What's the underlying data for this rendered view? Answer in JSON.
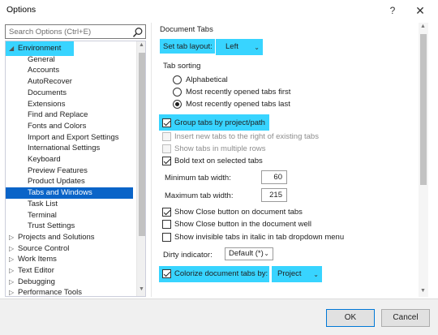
{
  "window": {
    "title": "Options",
    "help": "?",
    "close": "✕"
  },
  "search": {
    "placeholder": "Search Options (Ctrl+E)"
  },
  "tree": {
    "items": [
      {
        "label": "Environment",
        "level": 0,
        "expanded": true
      },
      {
        "label": "General",
        "level": 1
      },
      {
        "label": "Accounts",
        "level": 1
      },
      {
        "label": "AutoRecover",
        "level": 1
      },
      {
        "label": "Documents",
        "level": 1
      },
      {
        "label": "Extensions",
        "level": 1
      },
      {
        "label": "Find and Replace",
        "level": 1
      },
      {
        "label": "Fonts and Colors",
        "level": 1
      },
      {
        "label": "Import and Export Settings",
        "level": 1
      },
      {
        "label": "International Settings",
        "level": 1
      },
      {
        "label": "Keyboard",
        "level": 1
      },
      {
        "label": "Preview Features",
        "level": 1
      },
      {
        "label": "Product Updates",
        "level": 1
      },
      {
        "label": "Tabs and Windows",
        "level": 1,
        "selected": true
      },
      {
        "label": "Task List",
        "level": 1
      },
      {
        "label": "Terminal",
        "level": 1
      },
      {
        "label": "Trust Settings",
        "level": 1
      },
      {
        "label": "Projects and Solutions",
        "level": 0,
        "expanded": false
      },
      {
        "label": "Source Control",
        "level": 0,
        "expanded": false
      },
      {
        "label": "Work Items",
        "level": 0,
        "expanded": false
      },
      {
        "label": "Text Editor",
        "level": 0,
        "expanded": false
      },
      {
        "label": "Debugging",
        "level": 0,
        "expanded": false
      },
      {
        "label": "Performance Tools",
        "level": 0,
        "expanded": false
      }
    ]
  },
  "panel": {
    "section_title": "Document Tabs",
    "set_tab_layout_label": "Set tab layout:",
    "set_tab_layout_value": "Left",
    "tab_sorting_label": "Tab sorting",
    "sorting_options": [
      {
        "label": "Alphabetical",
        "checked": false
      },
      {
        "label": "Most recently opened tabs first",
        "checked": false
      },
      {
        "label": "Most recently opened tabs last",
        "checked": true
      }
    ],
    "group_tabs_label": "Group tabs by project/path",
    "insert_right_label": "Insert new tabs to the right of existing tabs",
    "show_multiple_rows_label": "Show tabs in multiple rows",
    "bold_text_label": "Bold text on selected tabs",
    "min_tab_width_label": "Minimum tab width:",
    "min_tab_width_value": "60",
    "max_tab_width_label": "Maximum tab width:",
    "max_tab_width_value": "215",
    "show_close_tab_label": "Show Close button on document tabs",
    "show_close_well_label": "Show Close button in the document well",
    "show_invisible_label": "Show invisible tabs in italic in tab dropdown menu",
    "dirty_indicator_label": "Dirty indicator:",
    "dirty_indicator_value": "Default (*)",
    "colorize_label": "Colorize document tabs by:",
    "colorize_value": "Project"
  },
  "footer": {
    "ok": "OK",
    "cancel": "Cancel"
  },
  "colors": {
    "accent": "#0a64c8",
    "highlight": "#38d4ff"
  },
  "icons": {
    "search": "search-icon",
    "dropdown": "chevron-down-icon"
  }
}
